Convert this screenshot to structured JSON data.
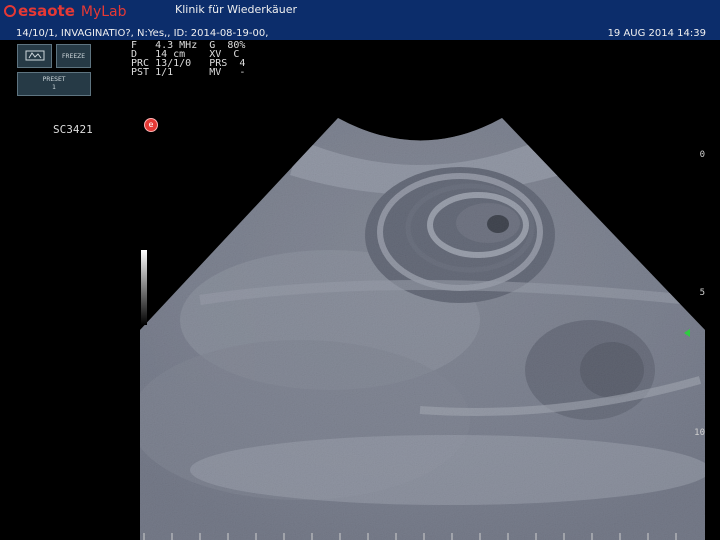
{
  "header": {
    "brand": "esaote",
    "product": "MyLab",
    "clinic": "Klinik für Wiederkäuer",
    "patient": "14/10/1, INVAGINATIO?, N:Yes,, ID: 2014-08-19-00,",
    "datetime": "19 AUG 2014 14:39"
  },
  "buttons": {
    "freeze": "FREEZE",
    "preset_line1": "PRESET",
    "preset_line2": "1"
  },
  "params": {
    "row1": "F   4.3 MHz  G  80%",
    "row2": "D   14 cm    XV  C",
    "row3": "PRC 13/1/0   PRS  4",
    "row4": "PST 1/1      MV   -"
  },
  "frame_id": "SC3421",
  "orientation_marker": "e",
  "depth_scale": {
    "d0": "0",
    "d5": "5",
    "d10": "10"
  },
  "icons": {
    "probe": "probe-icon",
    "orientation": "orientation-marker-icon",
    "focus": "focus-marker-icon"
  },
  "colors": {
    "header_bg": "#0c2d6b",
    "brand": "#e53935",
    "focus_marker": "#2ecc40"
  }
}
